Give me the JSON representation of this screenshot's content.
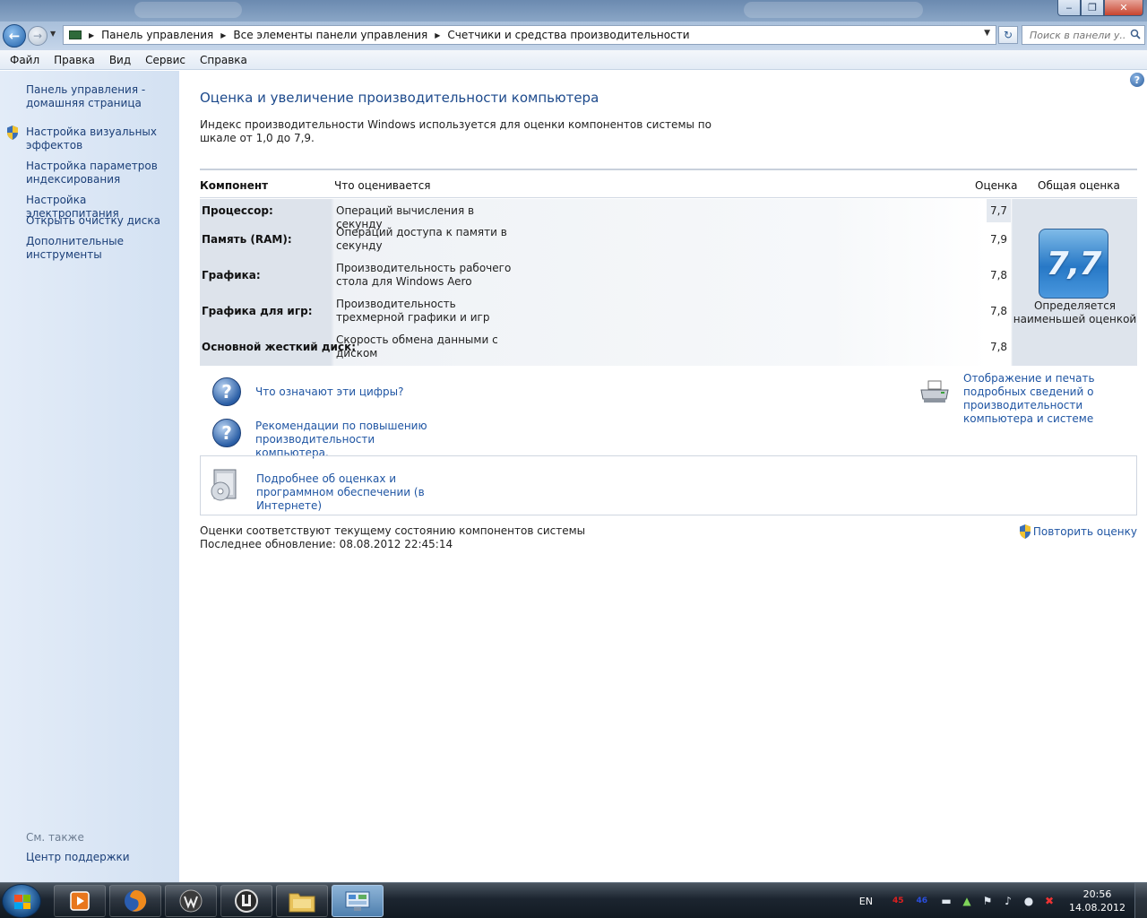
{
  "window": {
    "minimize_glyph": "‒",
    "maximize_glyph": "❐",
    "close_glyph": "✕"
  },
  "address": {
    "breadcrumbs": [
      "Панель управления",
      "Все элементы панели управления",
      "Счетчики и средства производительности"
    ],
    "search_placeholder": "Поиск в панели у...",
    "icons": [
      "back-arrow-icon",
      "forward-arrow-icon",
      "control-panel-icon",
      "refresh-icon",
      "search-icon"
    ]
  },
  "menu": [
    "Файл",
    "Правка",
    "Вид",
    "Сервис",
    "Справка"
  ],
  "sidebar": {
    "links": [
      "Панель управления - домашняя страница",
      "Настройка визуальных эффектов",
      "Настройка параметров индексирования",
      "Настройка электропитания",
      "Открыть очистку диска",
      "Дополнительные инструменты"
    ],
    "see_also": "См. также",
    "support": "Центр поддержки"
  },
  "main": {
    "title": "Оценка и увеличение производительности компьютера",
    "intro": "Индекс производительности Windows используется для оценки компонентов системы по шкале от 1,0 до 7,9.",
    "table": {
      "headers": {
        "component": "Компонент",
        "rated": "Что оценивается",
        "score": "Оценка",
        "base": "Общая оценка"
      },
      "rows": [
        {
          "name": "Процессор:",
          "desc": "Операций вычисления в секунду",
          "score": "7,7"
        },
        {
          "name": "Память (RAM):",
          "desc": "Операций доступа к памяти в секунду",
          "score": "7,9"
        },
        {
          "name": "Графика:",
          "desc": "Производительность рабочего стола для Windows Aero",
          "score": "7,8"
        },
        {
          "name": "Графика для игр:",
          "desc": "Производительность трехмерной графики и игр",
          "score": "7,8"
        },
        {
          "name": "Основной жесткий диск:",
          "desc": "Скорость обмена данными с диском",
          "score": "7,8"
        }
      ],
      "base_score": "7,7",
      "base_caption": "Определяется наименьшей оценкой"
    },
    "links": {
      "what_numbers": "Что означают эти цифры?",
      "tips": "Рекомендации по повышению производительности компьютера.",
      "print": "Отображение и печать подробных сведений о производительности компьютера и системе",
      "more_info": "Подробнее об оценках и программном обеспечении (в Интернете)"
    },
    "status": "Оценки соответствуют текущему состоянию компонентов системы",
    "last_update": "Последнее обновление: 08.08.2012 22:45:14",
    "rerun": "Повторить оценку"
  },
  "taskbar": {
    "items": [
      "media-player-icon",
      "firefox-icon",
      "world-of-tanks-icon",
      "game-client-icon",
      "explorer-icon",
      "control-panel-icon"
    ],
    "lang": "EN",
    "num_red": "45",
    "num_blue": "46",
    "time": "20:56",
    "date": "14.08.2012",
    "colors": {
      "red": "#e02020",
      "blue": "#2a4fe0"
    }
  }
}
